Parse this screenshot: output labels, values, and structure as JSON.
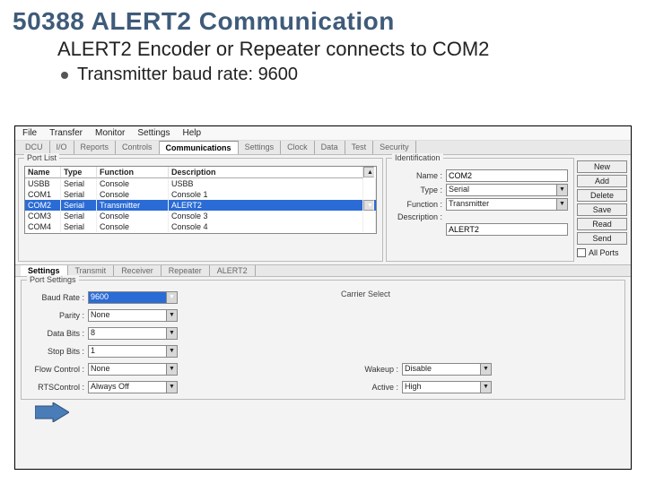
{
  "slide": {
    "title": "50388 ALERT2 Communication",
    "subtitle": "ALERT2 Encoder or Repeater connects to COM2",
    "bullet": "Transmitter baud rate: 9600"
  },
  "menubar": [
    "File",
    "Transfer",
    "Monitor",
    "Settings",
    "Help"
  ],
  "tabs": [
    "DCU",
    "I/O",
    "Reports",
    "Controls",
    "Communications",
    "Settings",
    "Clock",
    "Data",
    "Test",
    "Security"
  ],
  "active_tab": "Communications",
  "port_list": {
    "group_label": "Port List",
    "columns": [
      "Name",
      "Type",
      "Function",
      "Description"
    ],
    "rows": [
      {
        "name": "USBB",
        "type": "Serial",
        "func": "Console",
        "desc": "USBB"
      },
      {
        "name": "COM1",
        "type": "Serial",
        "func": "Console",
        "desc": "Console 1"
      },
      {
        "name": "COM2",
        "type": "Serial",
        "func": "Transmitter",
        "desc": "ALERT2"
      },
      {
        "name": "COM3",
        "type": "Serial",
        "func": "Console",
        "desc": "Console 3"
      },
      {
        "name": "COM4",
        "type": "Serial",
        "func": "Console",
        "desc": "Console 4"
      }
    ],
    "selected_index": 2
  },
  "ident": {
    "group_label": "Identification",
    "name_label": "Name :",
    "name_value": "COM2",
    "type_label": "Type :",
    "type_value": "Serial",
    "func_label": "Function :",
    "func_value": "Transmitter",
    "desc_label": "Description :",
    "desc_value": "ALERT2"
  },
  "buttons": {
    "new": "New",
    "add": "Add",
    "delete": "Delete",
    "save": "Save",
    "read": "Read",
    "send": "Send",
    "all_ports": "All Ports"
  },
  "sub_tabs": [
    "Settings",
    "Transmit",
    "Receiver",
    "Repeater",
    "ALERT2"
  ],
  "active_sub_tab": "Settings",
  "port_settings": {
    "group_label": "Port Settings",
    "baud_label": "Baud Rate :",
    "baud_value": "9600",
    "parity_label": "Parity :",
    "parity_value": "None",
    "databits_label": "Data Bits :",
    "databits_value": "8",
    "stopbits_label": "Stop Bits :",
    "stopbits_value": "1",
    "flow_label": "Flow Control :",
    "flow_value": "None",
    "rts_label": "RTSControl :",
    "rts_value": "Always Off",
    "col2_title": "Carrier Select",
    "wakeup_label": "Wakeup :",
    "wakeup_value": "Disable",
    "active_label": "Active :",
    "active_value": "High"
  }
}
